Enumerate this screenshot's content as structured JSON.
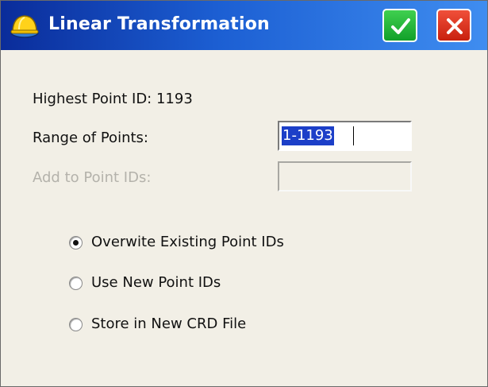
{
  "window": {
    "title": "Linear Transformation",
    "accept_icon": "checkmark-icon",
    "close_icon": "close-x-icon",
    "app_icon": "hardhat-icon"
  },
  "info": {
    "highest_point_label": "Highest Point ID: 1193"
  },
  "fields": {
    "range_label": "Range of Points:",
    "range_value": "1-1193",
    "add_label": "Add to Point IDs:",
    "add_value": ""
  },
  "options": [
    {
      "label": "Overwite Existing Point IDs",
      "selected": true
    },
    {
      "label": "Use New Point IDs",
      "selected": false
    },
    {
      "label": "Store in New CRD File",
      "selected": false
    }
  ],
  "colors": {
    "titlebar": "#1c5fd3",
    "accept": "#12a02a",
    "close": "#c8200e",
    "selection": "#1c3fc8"
  }
}
